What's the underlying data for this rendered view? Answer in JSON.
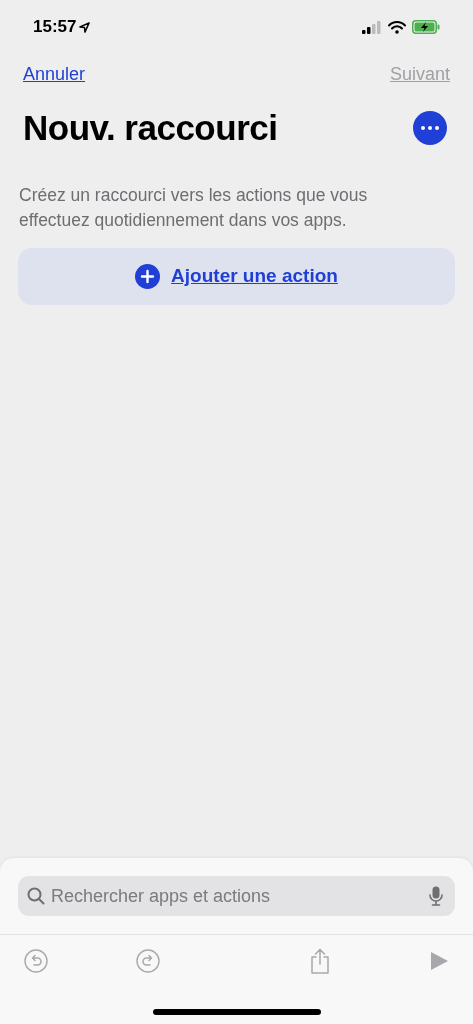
{
  "status_bar": {
    "time": "15:57"
  },
  "nav": {
    "cancel": {
      "label": "Annuler",
      "disabled": false
    },
    "next": {
      "label": "Suivant",
      "disabled": true
    }
  },
  "title": "Nouv. raccourci",
  "description": "Créez un raccourci vers les actions que vous effectuez quotidiennement dans vos apps.",
  "add_action": {
    "label": "Ajouter une action"
  },
  "search": {
    "placeholder": "Rechercher apps et actions"
  },
  "toolbar": [
    {
      "kind": "undo",
      "disabled": true
    },
    {
      "kind": "redo",
      "disabled": true
    },
    {
      "kind": "share",
      "disabled": true
    },
    {
      "kind": "play",
      "disabled": true
    }
  ]
}
